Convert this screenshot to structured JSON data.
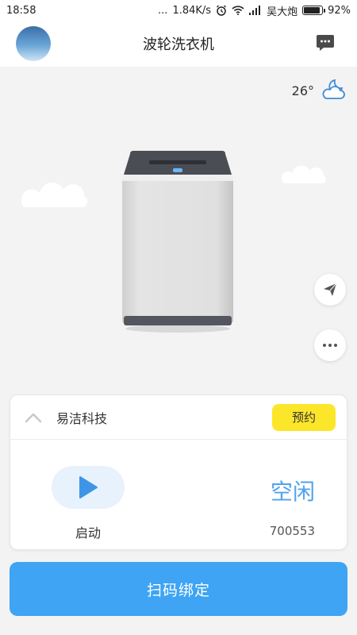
{
  "status_bar": {
    "time": "18:58",
    "dots": "...",
    "speed": "1.84K/s",
    "carrier": "吴大炮",
    "battery_percent": "92%",
    "battery_level": 0.92,
    "icons": [
      "alarm-icon",
      "wifi-icon",
      "signal-icon",
      "battery-icon"
    ]
  },
  "header": {
    "title": "波轮洗衣机",
    "avatar": "avatar",
    "message_icon": "message-icon"
  },
  "weather": {
    "temperature": "26°",
    "icon": "cloud-moon-icon"
  },
  "side_actions": {
    "share_icon": "paper-plane-icon",
    "more_icon": "more-dots-icon"
  },
  "card": {
    "company": "易洁科技",
    "reserve_label": "预约",
    "start_label": "启动",
    "status": "空闲",
    "device_id": "700553"
  },
  "bind_button": {
    "label": "扫码绑定"
  },
  "colors": {
    "accent_blue": "#3ea4f3",
    "status_blue": "#4ea3ee",
    "reserve_yellow": "#fce62a",
    "background": "#f3f3f3"
  }
}
